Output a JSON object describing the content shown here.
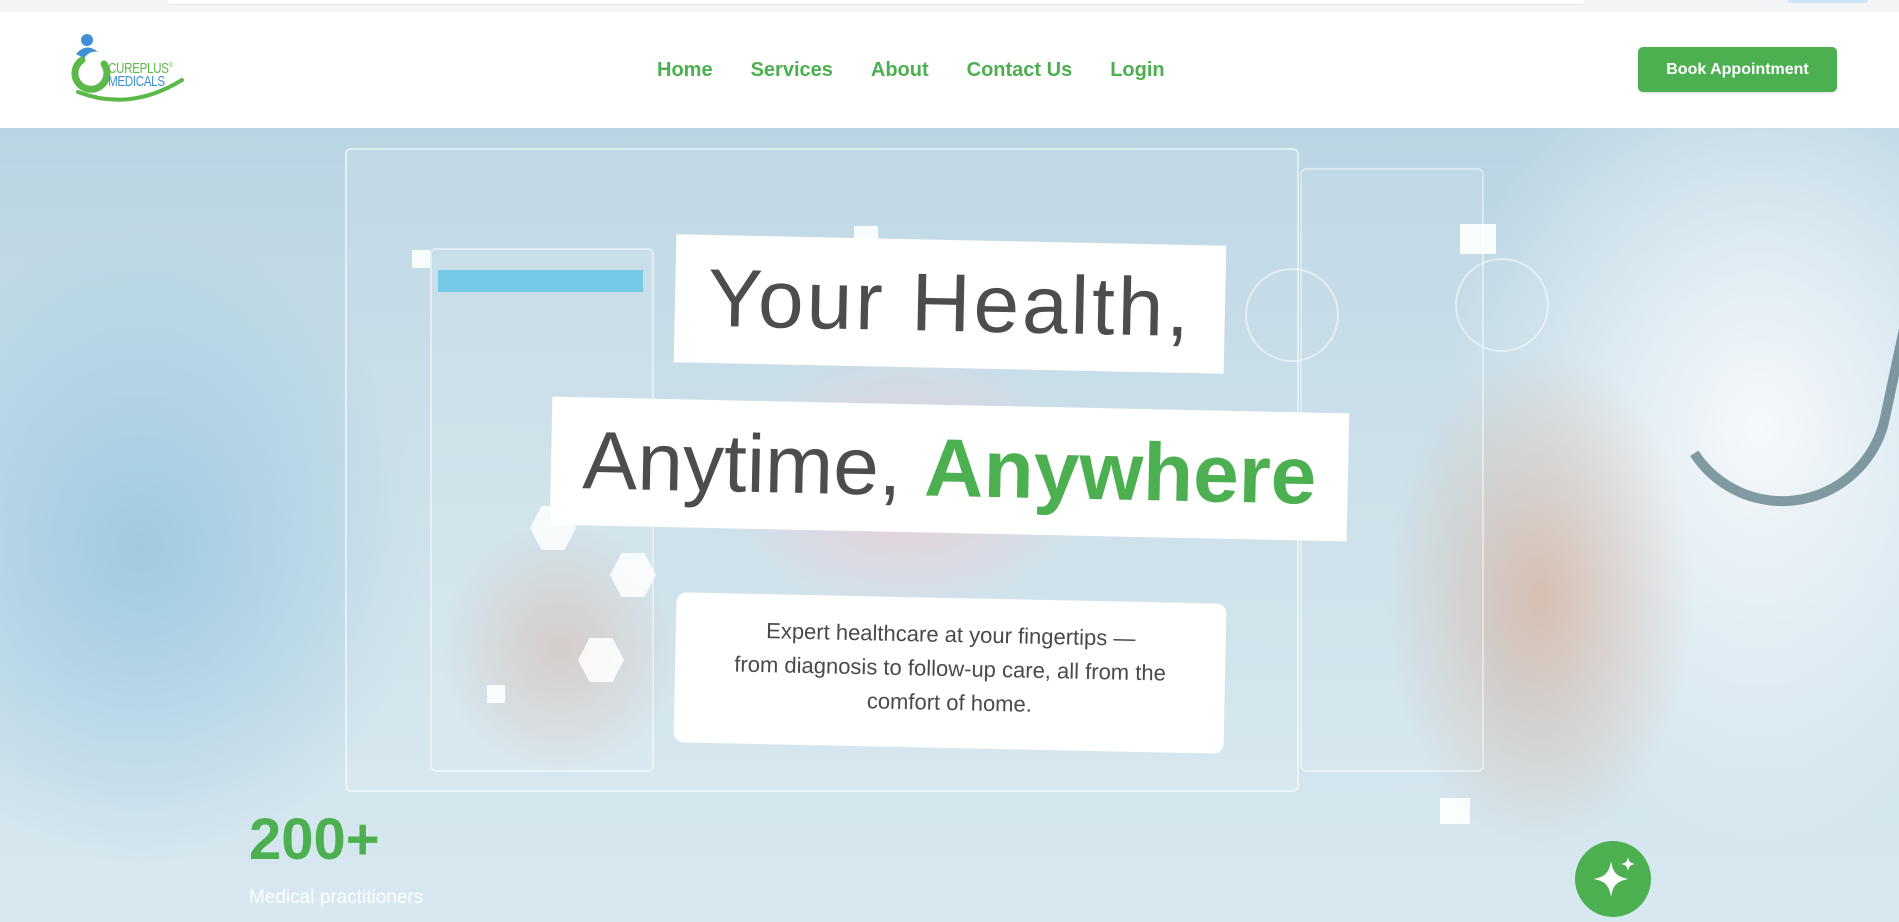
{
  "brand": {
    "line1": "CUREPLUS",
    "line2": "MEDICALS",
    "reg_mark": "®"
  },
  "nav": {
    "items": [
      "Home",
      "Services",
      "About",
      "Contact Us",
      "Login"
    ]
  },
  "header": {
    "cta_label": "Book Appointment"
  },
  "hero": {
    "title_line1": "Your Health,",
    "title_line2_prefix": "Anytime,",
    "title_line2_highlight": "Anywhere",
    "subtitle_lines": [
      "Expert healthcare at your fingertips —",
      "from diagnosis to follow-up care, all from the",
      "comfort of home."
    ],
    "stat_value": "200+",
    "stat_label": "Medical practitioners"
  },
  "icons": {
    "fab": "sparkle-icon",
    "logo": "cureplus-logo-icon"
  },
  "colors": {
    "brand_green": "#4caf50",
    "logo_blue": "#3f8fd6",
    "text_dark": "#4d4d4d"
  }
}
